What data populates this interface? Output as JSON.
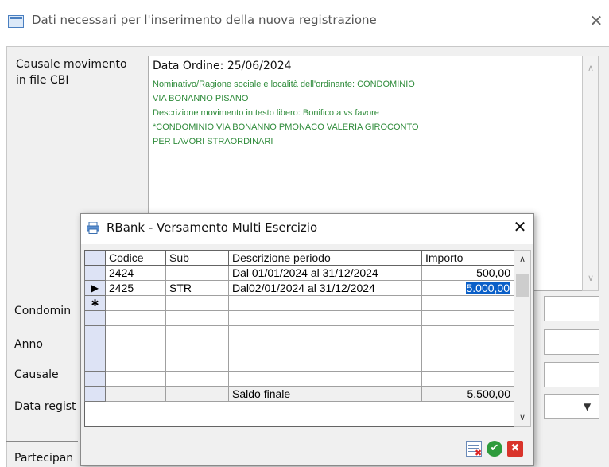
{
  "window": {
    "title": "Dati necessari per l'inserimento della nuova registrazione",
    "close_glyph": "✕"
  },
  "form": {
    "causale_label_line1": "Causale movimento",
    "causale_label_line2": "in file CBI",
    "memo_header": "Data Ordine: 25/06/2024",
    "memo_body": "Nominativo/Ragione sociale e località dell'ordinante: CONDOMINIO\nVIA BONANNO PISANO\nDescrizione movimento in testo libero: Bonifico a vs favore\n*CONDOMINIO VIA BONANNO PMONACO VALERIA GIROCONTO\nPER LAVORI STRAORDINARI",
    "labels": {
      "condominio": "Condomin",
      "anno": "Anno",
      "causale": "Causale",
      "data_registrazione": "Data regist",
      "partecipante": "Partecipan"
    },
    "accent_text_color": "#2e8b3a"
  },
  "dialog": {
    "title": "RBank - Versamento Multi Esercizio",
    "close_glyph": "✕",
    "grid": {
      "columns": [
        "Codice",
        "Sub",
        "Descrizione periodo",
        "Importo"
      ],
      "rows": [
        {
          "indicator": "",
          "codice": "2424",
          "sub": "",
          "descrizione": "Dal 01/01/2024 al 31/12/2024",
          "importo": "500,00"
        },
        {
          "indicator": "▶",
          "codice": "2425",
          "sub": "STR",
          "descrizione": "Dal02/01/2024 al 31/12/2024",
          "importo": "5.000,00"
        },
        {
          "indicator": "✱",
          "codice": "",
          "sub": "",
          "descrizione": "",
          "importo": ""
        }
      ],
      "footer": {
        "label": "Saldo finale",
        "value": "5.500,00"
      },
      "selected_cell_color": "#0a5fc8"
    },
    "buttons": {
      "table_icon": "table-delete-icon",
      "ok_glyph": "✔",
      "cancel_glyph": "✖"
    }
  }
}
